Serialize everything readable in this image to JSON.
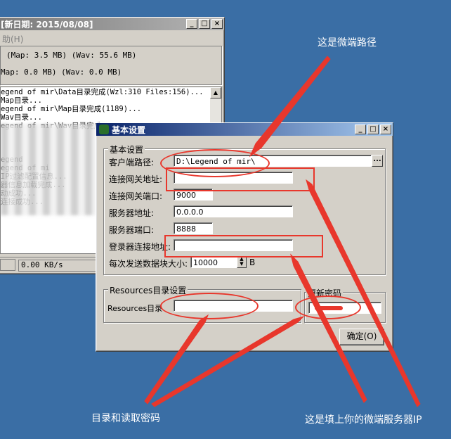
{
  "bg_window": {
    "title": "[新日期: 2015/08/08]",
    "menu": "助(H)",
    "stat1": "(Map: 3.5 MB)  (Wav: 55.6 MB)",
    "stat2": "Map: 0.0 MB)  (Wav: 0.0 MB)",
    "log_lines": [
      "egend of mir\\Data目录完成(Wzl:310 Files:156)...",
      "Map目录...",
      "egend of mir\\Map目录完成(1189)...",
      "Wav目录...",
      "egend of mir\\Wav目录完成...",
      "",
      "",
      "",
      "egend",
      "egend of mi",
      "IP过滤配置信息...",
      "器信息加载完成...",
      "动成功...",
      "连接成功..."
    ],
    "speed": "0.00 KB/s"
  },
  "dialog": {
    "title": "基本设置",
    "basic_group": "基本设置",
    "client_path_label": "客户端路径:",
    "client_path_value": "D:\\Legend of mir\\",
    "browse_btn": "...",
    "gateway_addr_label": "连接网关地址:",
    "gateway_addr_value": "",
    "gateway_port_label": "连接网关端口:",
    "gateway_port_value": "9000",
    "server_addr_label": "服务器地址:",
    "server_addr_value": "0.0.0.0",
    "server_port_label": "服务器端口:",
    "server_port_value": "8888",
    "login_addr_label": "登录器连接地址:",
    "login_addr_value": "",
    "block_size_label": "每次发送数据块大小:",
    "block_size_value": "10000",
    "block_unit": "B",
    "resources_group": "Resources目录设置",
    "resources_label": "Resources目录",
    "resources_value": "",
    "password_group": "更新密码",
    "ok_btn": "确定(O)"
  },
  "annotations": {
    "top": "这是微端路径",
    "bottom_left": "目录和读取密码",
    "bottom_right": "这是填上你的微端服务器IP"
  },
  "colors": {
    "desktop": "#3a6ea5",
    "annotation": "#e8372c"
  }
}
